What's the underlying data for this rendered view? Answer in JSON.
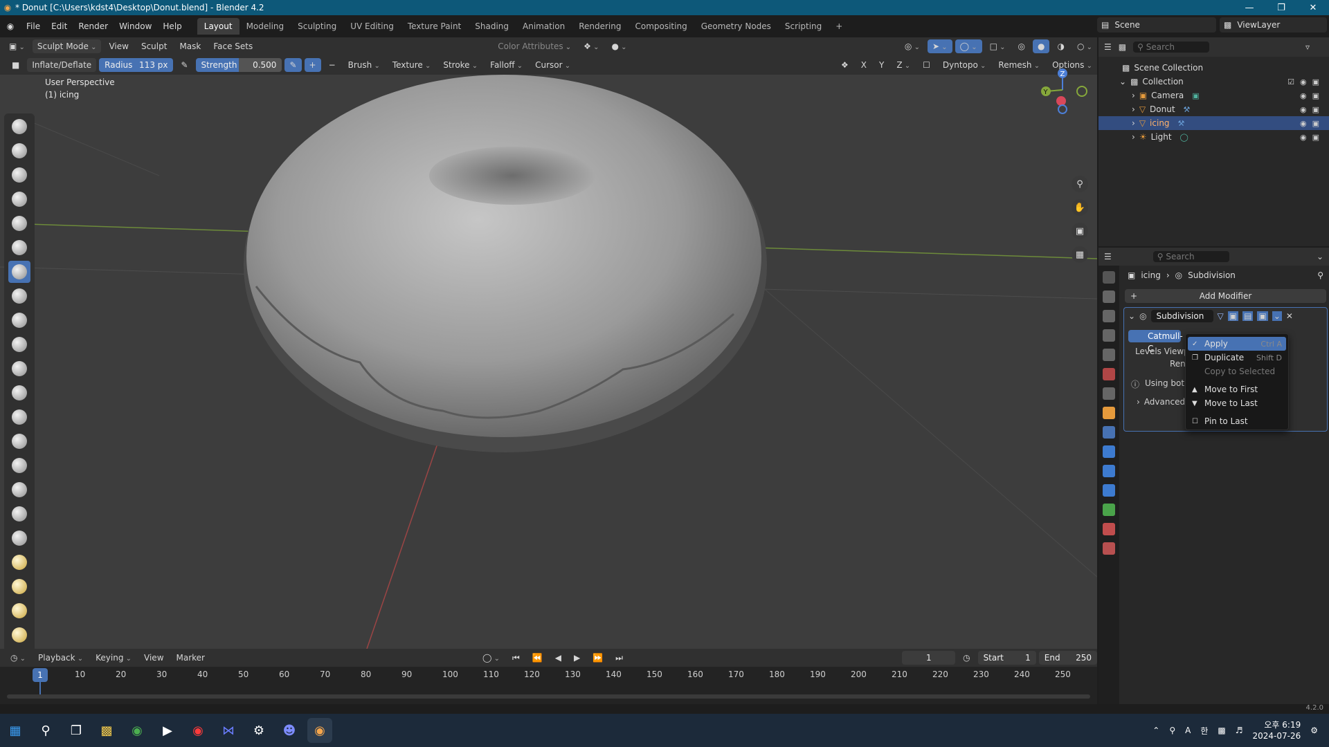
{
  "window": {
    "title": "* Donut [C:\\Users\\kdst4\\Desktop\\Donut.blend] - Blender 4.2"
  },
  "menu": [
    "File",
    "Edit",
    "Render",
    "Window",
    "Help"
  ],
  "workspaces": [
    "Layout",
    "Modeling",
    "Sculpting",
    "UV Editing",
    "Texture Paint",
    "Shading",
    "Animation",
    "Rendering",
    "Compositing",
    "Geometry Nodes",
    "Scripting"
  ],
  "scene": {
    "name": "Scene",
    "view_layer": "ViewLayer"
  },
  "viewport_header": {
    "mode": "Sculpt Mode",
    "menus": [
      "View",
      "Sculpt",
      "Mask",
      "Face Sets"
    ],
    "color_attr": "Color Attributes"
  },
  "tool_header": {
    "brush": "Inflate/Deflate",
    "radius_label": "Radius",
    "radius_value": "113 px",
    "strength_label": "Strength",
    "strength_value": "0.500",
    "dropdowns": [
      "Brush",
      "Texture",
      "Stroke",
      "Falloff",
      "Cursor"
    ],
    "axes": [
      "X",
      "Y",
      "Z"
    ],
    "dyntopo": "Dyntopo",
    "remesh": "Remesh",
    "options": "Options"
  },
  "viewport_info": {
    "line1": "User Perspective",
    "line2": "(1) icing"
  },
  "gizmo": {
    "z": "Z",
    "y": "Y"
  },
  "outliner": {
    "search_placeholder": "Search",
    "scene_collection": "Scene Collection",
    "collection": "Collection",
    "items": [
      {
        "name": "Camera",
        "selected": false
      },
      {
        "name": "Donut",
        "selected": false
      },
      {
        "name": "icing",
        "selected": true
      },
      {
        "name": "Light",
        "selected": false
      }
    ]
  },
  "properties": {
    "search_placeholder": "Search",
    "breadcrumb_obj": "icing",
    "breadcrumb_mod": "Subdivision",
    "add_modifier": "Add Modifier",
    "modifier_name": "Subdivision",
    "algorithm": "Catmull-C",
    "levels_viewport": "Levels Viewp",
    "render": "Rend",
    "using_both": "Using both",
    "advanced": "Advanced"
  },
  "context_menu": {
    "items": [
      {
        "label": "Apply",
        "shortcut": "Ctrl A",
        "icon": "✓",
        "highlight": true,
        "disabled": false
      },
      {
        "label": "Duplicate",
        "shortcut": "Shift D",
        "icon": "❐",
        "highlight": false,
        "disabled": false
      },
      {
        "label": "Copy to Selected",
        "shortcut": "",
        "icon": "",
        "highlight": false,
        "disabled": true
      },
      {
        "label": "Move to First",
        "shortcut": "",
        "icon": "▲",
        "highlight": false,
        "disabled": false
      },
      {
        "label": "Move to Last",
        "shortcut": "",
        "icon": "▼",
        "highlight": false,
        "disabled": false
      },
      {
        "label": "Pin to Last",
        "shortcut": "",
        "icon": "☐",
        "highlight": false,
        "disabled": false
      }
    ]
  },
  "timeline": {
    "menus": [
      "Playback",
      "Keying",
      "View",
      "Marker"
    ],
    "current_frame": "1",
    "start_label": "Start",
    "start": "1",
    "end_label": "End",
    "end": "250",
    "ticks": [
      "10",
      "20",
      "30",
      "40",
      "50",
      "60",
      "70",
      "80",
      "90",
      "100",
      "110",
      "120",
      "130",
      "140",
      "150",
      "160",
      "170",
      "180",
      "190",
      "200",
      "210",
      "220",
      "230",
      "240",
      "250"
    ]
  },
  "version": "4.2.0",
  "taskbar": {
    "time": "오후 6:19",
    "date": "2024-07-26",
    "ime": "A",
    "ime2": "한"
  }
}
